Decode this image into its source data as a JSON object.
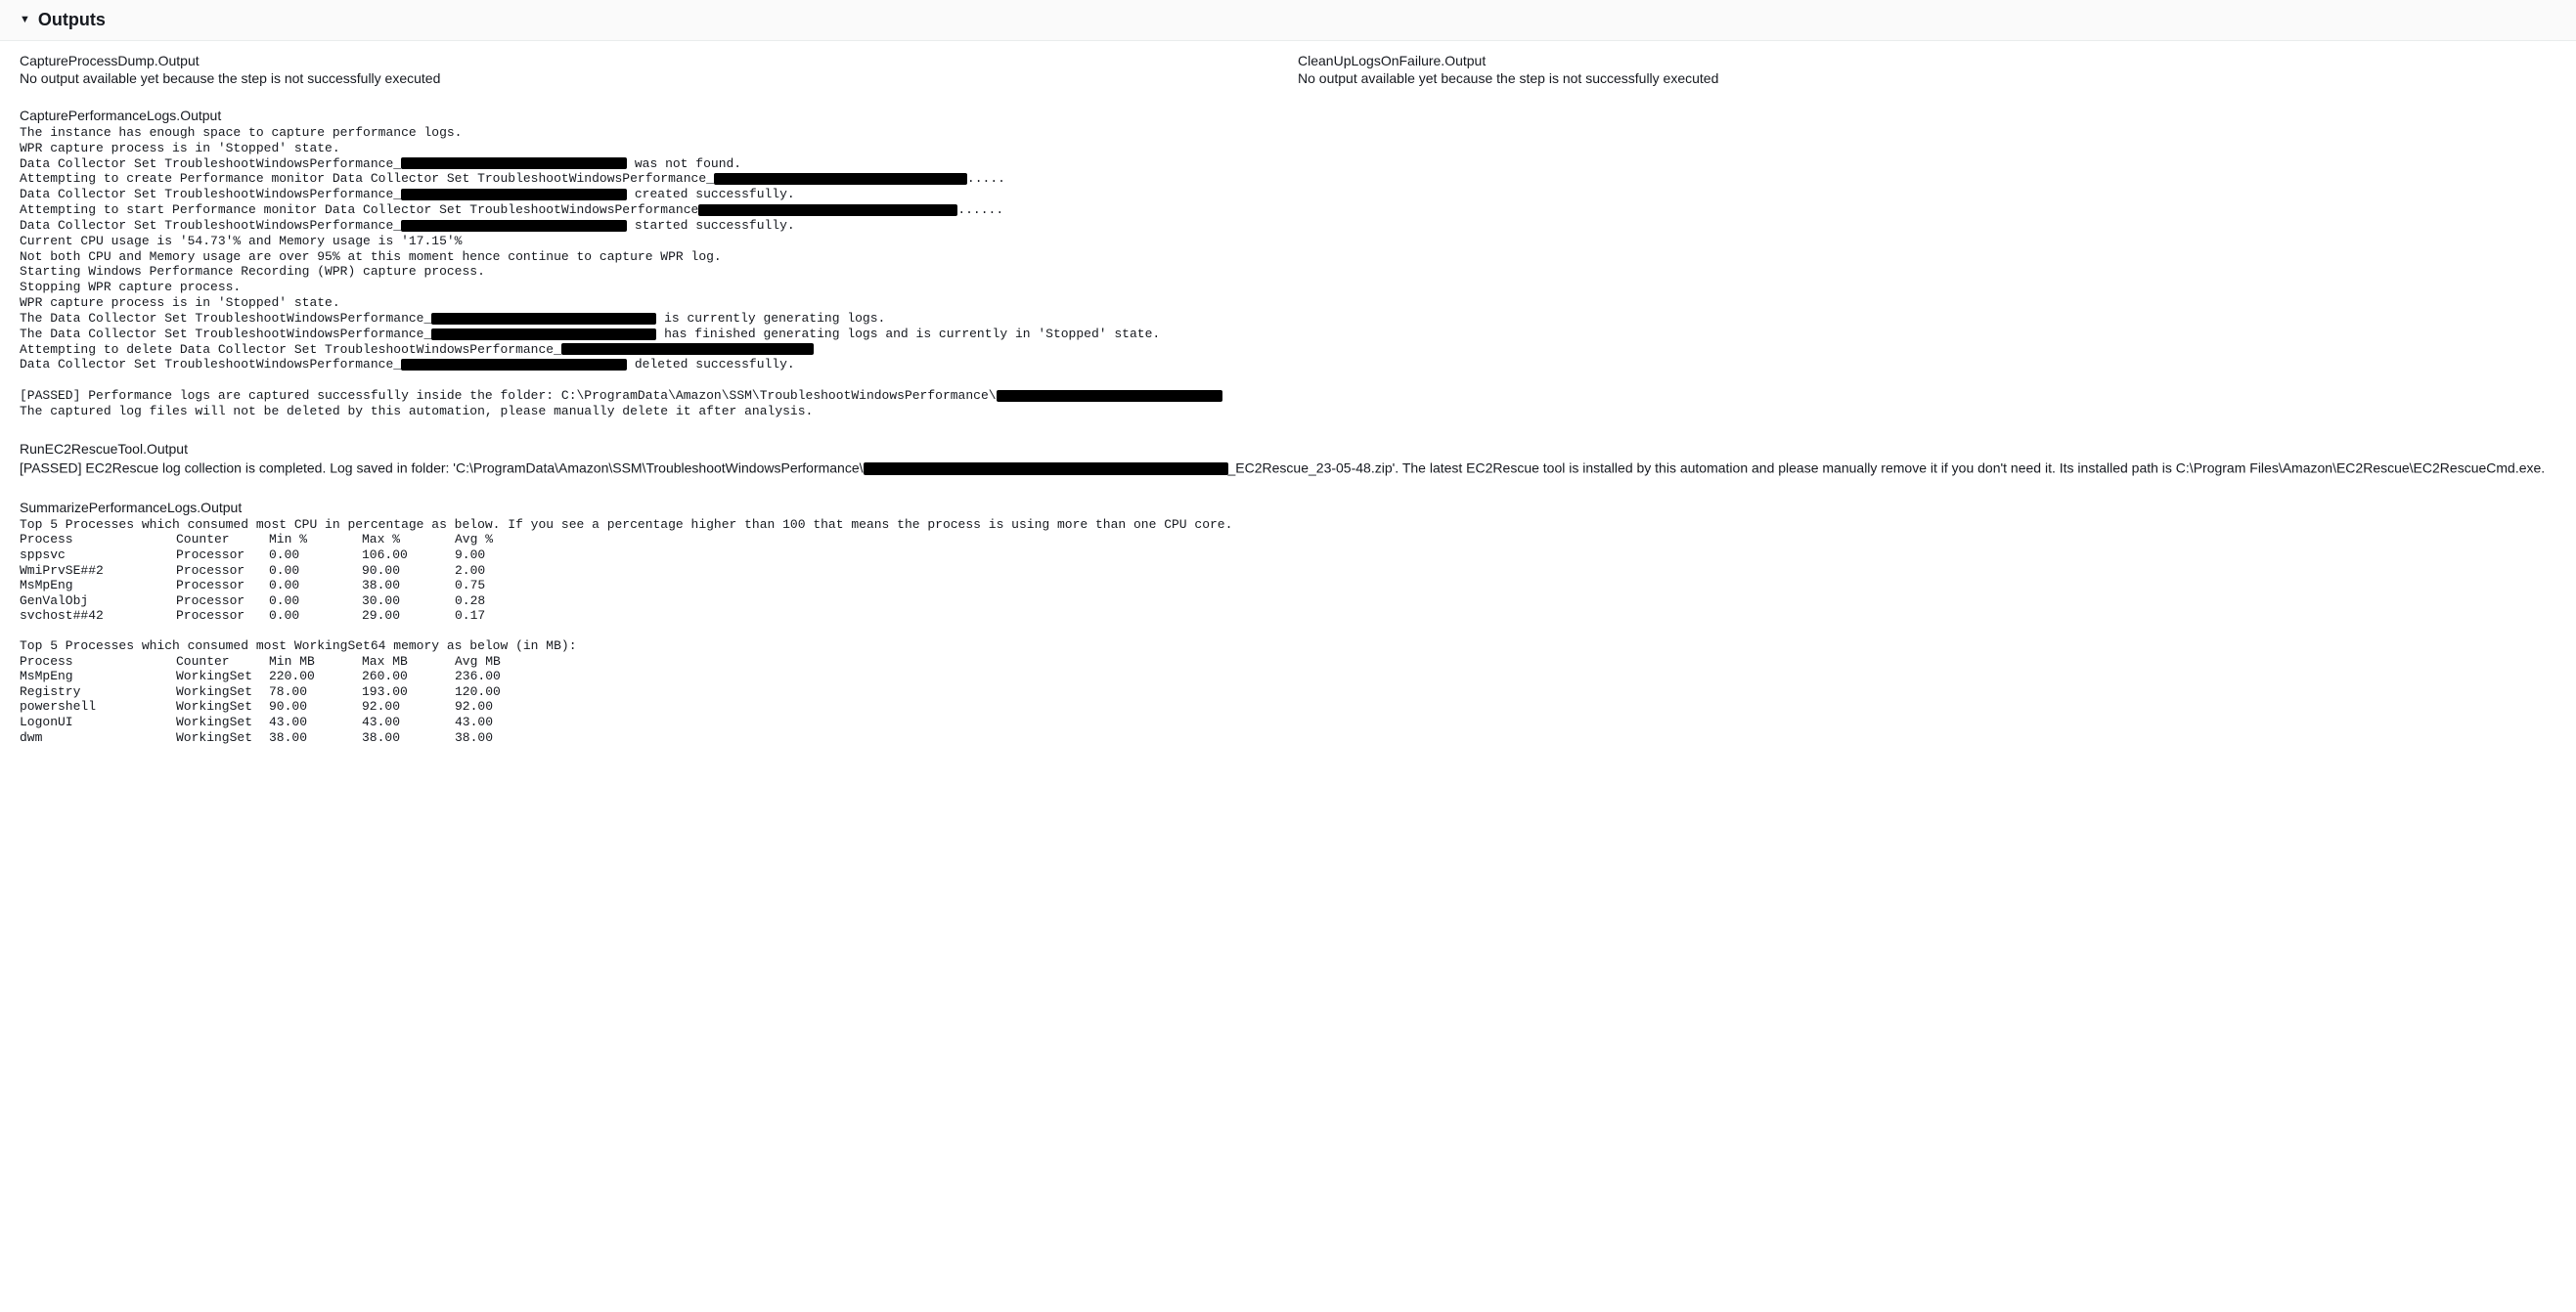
{
  "header": {
    "title": "Outputs"
  },
  "captureProcessDump": {
    "title": "CaptureProcessDump.Output",
    "message": "No output available yet because the step is not successfully executed"
  },
  "cleanUpLogs": {
    "title": "CleanUpLogsOnFailure.Output",
    "message": "No output available yet because the step is not successfully executed"
  },
  "capturePerf": {
    "title": "CapturePerformanceLogs.Output",
    "lines": [
      [
        {
          "t": "The instance has enough space to capture performance logs."
        }
      ],
      [
        {
          "t": "WPR capture process is in 'Stopped' state."
        }
      ],
      [
        {
          "t": "Data Collector Set TroubleshootWindowsPerformance_"
        },
        {
          "r": 231
        },
        {
          "t": " was not found."
        }
      ],
      [
        {
          "t": "Attempting to create Performance monitor Data Collector Set TroubleshootWindowsPerformance_"
        },
        {
          "r": 259
        },
        {
          "t": "....."
        }
      ],
      [
        {
          "t": "Data Collector Set TroubleshootWindowsPerformance_"
        },
        {
          "r": 231
        },
        {
          "t": " created successfully."
        }
      ],
      [
        {
          "t": "Attempting to start Performance monitor Data Collector Set TroubleshootWindowsPerformance"
        },
        {
          "r": 265
        },
        {
          "t": "......"
        }
      ],
      [
        {
          "t": "Data Collector Set TroubleshootWindowsPerformance_"
        },
        {
          "r": 231
        },
        {
          "t": " started successfully."
        }
      ],
      [
        {
          "t": "Current CPU usage is '54.73'% and Memory usage is '17.15'%"
        }
      ],
      [
        {
          "t": "Not both CPU and Memory usage are over 95% at this moment hence continue to capture WPR log."
        }
      ],
      [
        {
          "t": "Starting Windows Performance Recording (WPR) capture process."
        }
      ],
      [
        {
          "t": "Stopping WPR capture process."
        }
      ],
      [
        {
          "t": "WPR capture process is in 'Stopped' state."
        }
      ],
      [
        {
          "t": "The Data Collector Set TroubleshootWindowsPerformance_"
        },
        {
          "r": 230
        },
        {
          "t": " is currently generating logs."
        }
      ],
      [
        {
          "t": "The Data Collector Set TroubleshootWindowsPerformance_"
        },
        {
          "r": 230
        },
        {
          "t": " has finished generating logs and is currently in 'Stopped' state."
        }
      ],
      [
        {
          "t": "Attempting to delete Data Collector Set TroubleshootWindowsPerformance_"
        },
        {
          "r": 258
        }
      ],
      [
        {
          "t": "Data Collector Set TroubleshootWindowsPerformance_"
        },
        {
          "r": 231
        },
        {
          "t": " deleted successfully."
        }
      ],
      [
        {
          "t": " "
        }
      ],
      [
        {
          "t": "[PASSED] Performance logs are captured successfully inside the folder: C:\\ProgramData\\Amazon\\SSM\\TroubleshootWindowsPerformance\\"
        },
        {
          "r": 231
        }
      ],
      [
        {
          "t": "The captured log files will not be deleted by this automation, please manually delete it after analysis."
        }
      ]
    ]
  },
  "ec2Rescue": {
    "title": "RunEC2RescueTool.Output",
    "segs": [
      {
        "t": "[PASSED] EC2Rescue log collection is completed. Log saved in folder: 'C:\\ProgramData\\Amazon\\SSM\\TroubleshootWindowsPerformance\\"
      },
      {
        "r": 373
      },
      {
        "t": "_EC2Rescue_23-05-48.zip'. The latest EC2Rescue tool is installed by this automation and please manually remove it if you don't need it. Its installed path is C:\\Program Files\\Amazon\\EC2Rescue\\EC2RescueCmd.exe."
      }
    ]
  },
  "summarize": {
    "title": "SummarizePerformanceLogs.Output",
    "cpu_intro": "Top 5 Processes which consumed most CPU in percentage as below. If you see a percentage higher than 100 that means the process is using more than one CPU core.",
    "cpu_headers": [
      "Process",
      "Counter",
      "Min %",
      "Max %",
      "Avg %"
    ],
    "cpu_rows": [
      [
        "sppsvc",
        "Processor",
        "0.00",
        "106.00",
        "9.00"
      ],
      [
        "WmiPrvSE##2",
        "Processor",
        "0.00",
        "90.00",
        "2.00"
      ],
      [
        "MsMpEng",
        "Processor",
        "0.00",
        "38.00",
        "0.75"
      ],
      [
        "GenValObj",
        "Processor",
        "0.00",
        "30.00",
        "0.28"
      ],
      [
        "svchost##42",
        "Processor",
        "0.00",
        "29.00",
        "0.17"
      ]
    ],
    "mem_intro": "Top 5 Processes which consumed most WorkingSet64 memory as below (in MB):",
    "mem_headers": [
      "Process",
      "Counter",
      "Min MB",
      "Max MB",
      "Avg MB"
    ],
    "mem_rows": [
      [
        "MsMpEng",
        "WorkingSet",
        "220.00",
        "260.00",
        "236.00"
      ],
      [
        "Registry",
        "WorkingSet",
        "78.00",
        "193.00",
        "120.00"
      ],
      [
        "powershell",
        "WorkingSet",
        "90.00",
        "92.00",
        "92.00"
      ],
      [
        "LogonUI",
        "WorkingSet",
        "43.00",
        "43.00",
        "43.00"
      ],
      [
        "dwm",
        "WorkingSet",
        "38.00",
        "38.00",
        "38.00"
      ]
    ]
  }
}
